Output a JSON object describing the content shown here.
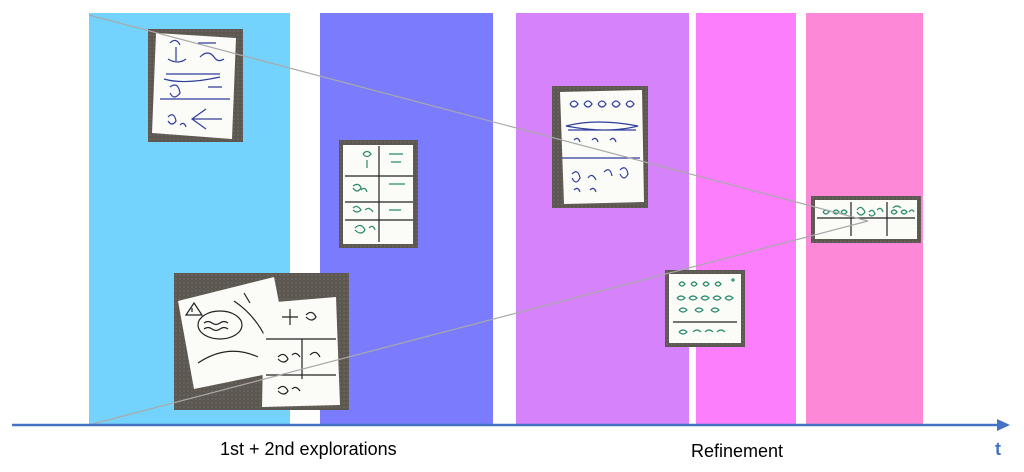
{
  "timeline": {
    "phase_labels": [
      "1st + 2nd explorations",
      "Refinement"
    ],
    "axis_label": "t"
  },
  "colors": {
    "band_1": "#74d3fd",
    "band_2": "#7a7cfd",
    "band_3": "#d683fb",
    "band_4": "#fd7efd",
    "band_5": "#fd88d8",
    "axis": "#4472c4"
  }
}
